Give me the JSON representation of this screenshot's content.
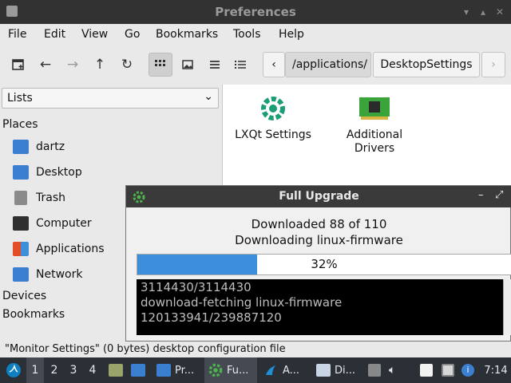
{
  "window": {
    "title": "Preferences"
  },
  "menu": [
    "File",
    "Edit",
    "View",
    "Go",
    "Bookmarks",
    "Tools",
    "Help"
  ],
  "toolbar": {
    "path_segments": [
      "/applications/",
      "DesktopSettings"
    ]
  },
  "sidebar": {
    "lists_label": "Lists",
    "places_label": "Places",
    "items": [
      "dartz",
      "Desktop",
      "Trash",
      "Computer",
      "Applications",
      "Network"
    ],
    "devices_label": "Devices",
    "bookmarks_label": "Bookmarks"
  },
  "main": {
    "items": [
      {
        "label": "LXQt Settings"
      },
      {
        "label": "Additional\nDrivers"
      }
    ]
  },
  "dialog": {
    "title": "Full Upgrade",
    "line1": "Downloaded 88 of 110",
    "line2": "Downloading linux-firmware",
    "progress_fraction": 0.32,
    "progress_text": "32%",
    "terminal_lines": [
      "3114430/3114430",
      "download-fetching linux-firmware",
      "120133941/239887120"
    ]
  },
  "status": {
    "text": "\"Monitor Settings\" (0 bytes) desktop configuration file"
  },
  "taskbar": {
    "workspaces": [
      "1",
      "2",
      "3",
      "4"
    ],
    "tasks": [
      "Pr...",
      "Fu...",
      "A...",
      "Di..."
    ],
    "clock": "7:14"
  },
  "colors": {
    "accent": "#3d8fdc",
    "titlebar": "#323232",
    "taskbar": "#2b2f36"
  }
}
